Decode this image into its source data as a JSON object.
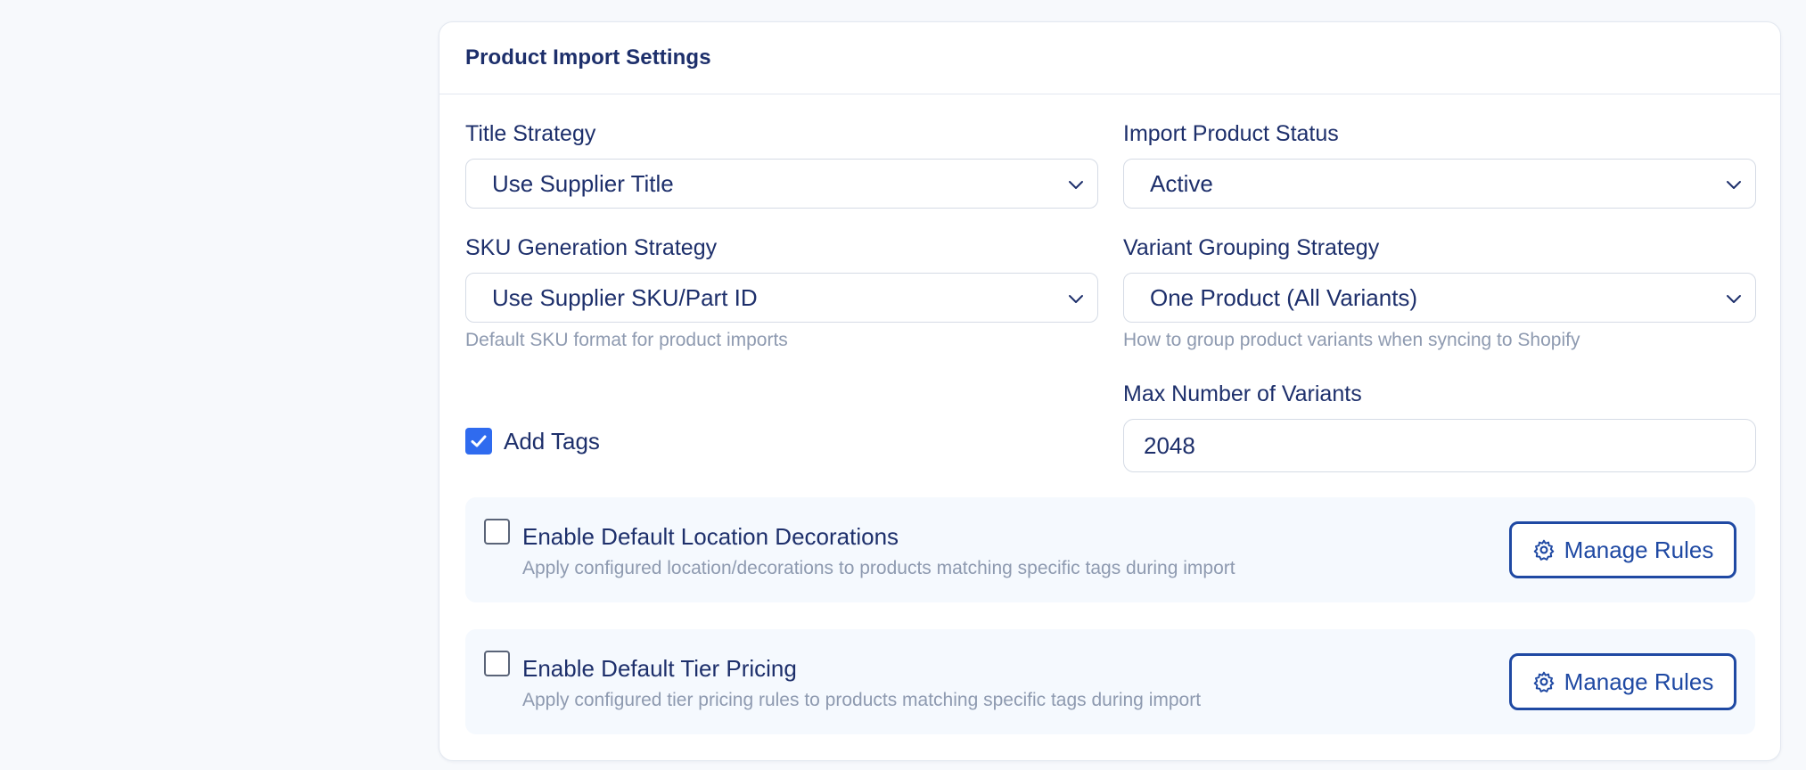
{
  "header": {
    "title": "Product Import Settings"
  },
  "title_strategy": {
    "label": "Title Strategy",
    "value": "Use Supplier Title"
  },
  "import_status": {
    "label": "Import Product Status",
    "value": "Active"
  },
  "sku_strategy": {
    "label": "SKU Generation Strategy",
    "value": "Use Supplier SKU/Part ID",
    "hint": "Default SKU format for product imports"
  },
  "variant_grouping": {
    "label": "Variant Grouping Strategy",
    "value": "One Product (All Variants)",
    "hint": "How to group product variants when syncing to Shopify"
  },
  "max_variants": {
    "label": "Max Number of Variants",
    "value": "2048"
  },
  "add_tags": {
    "label": "Add Tags",
    "checked": true
  },
  "location_decorations": {
    "title": "Enable Default Location Decorations",
    "description": "Apply configured location/decorations to products matching specific tags during import",
    "checked": false,
    "button_label": "Manage Rules"
  },
  "tier_pricing": {
    "title": "Enable Default Tier Pricing",
    "description": "Apply configured tier pricing rules to products matching specific tags during import",
    "checked": false,
    "button_label": "Manage Rules"
  },
  "colors": {
    "accent": "#2f6bef",
    "button_border": "#1f49a3",
    "text": "#1d2f6b",
    "muted": "#8e9ab0"
  }
}
